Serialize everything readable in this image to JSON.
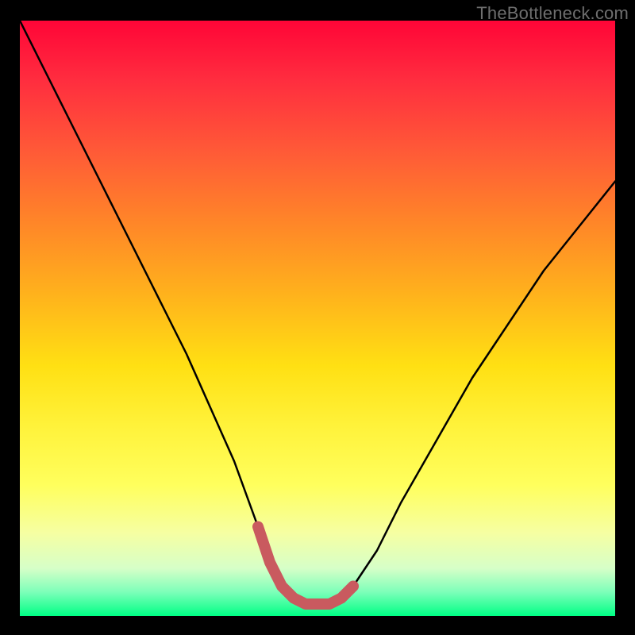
{
  "watermark": {
    "text": "TheBottleneck.com"
  },
  "colors": {
    "background": "#000000",
    "curve": "#000000",
    "accent": "#c95a5f",
    "gradient_top": "#ff0537",
    "gradient_bottom": "#00ff85"
  },
  "chart_data": {
    "type": "line",
    "title": "",
    "xlabel": "",
    "ylabel": "",
    "xlim": [
      0,
      100
    ],
    "ylim": [
      0,
      100
    ],
    "grid": false,
    "x": [
      0,
      4,
      8,
      12,
      16,
      20,
      24,
      28,
      32,
      36,
      40,
      42,
      44,
      46,
      48,
      50,
      52,
      54,
      56,
      60,
      64,
      68,
      72,
      76,
      80,
      84,
      88,
      92,
      96,
      100
    ],
    "series": [
      {
        "name": "bottleneck-curve",
        "values": [
          100,
          92,
          84,
          76,
          68,
          60,
          52,
          44,
          35,
          26,
          15,
          9,
          5,
          3,
          2,
          2,
          2,
          3,
          5,
          11,
          19,
          26,
          33,
          40,
          46,
          52,
          58,
          63,
          68,
          73
        ]
      }
    ],
    "accent_segment": {
      "name": "optimal-range",
      "x": [
        40,
        42,
        44,
        46,
        48,
        50,
        52,
        54,
        56
      ],
      "values": [
        15,
        9,
        5,
        3,
        2,
        2,
        2,
        3,
        5
      ]
    }
  }
}
